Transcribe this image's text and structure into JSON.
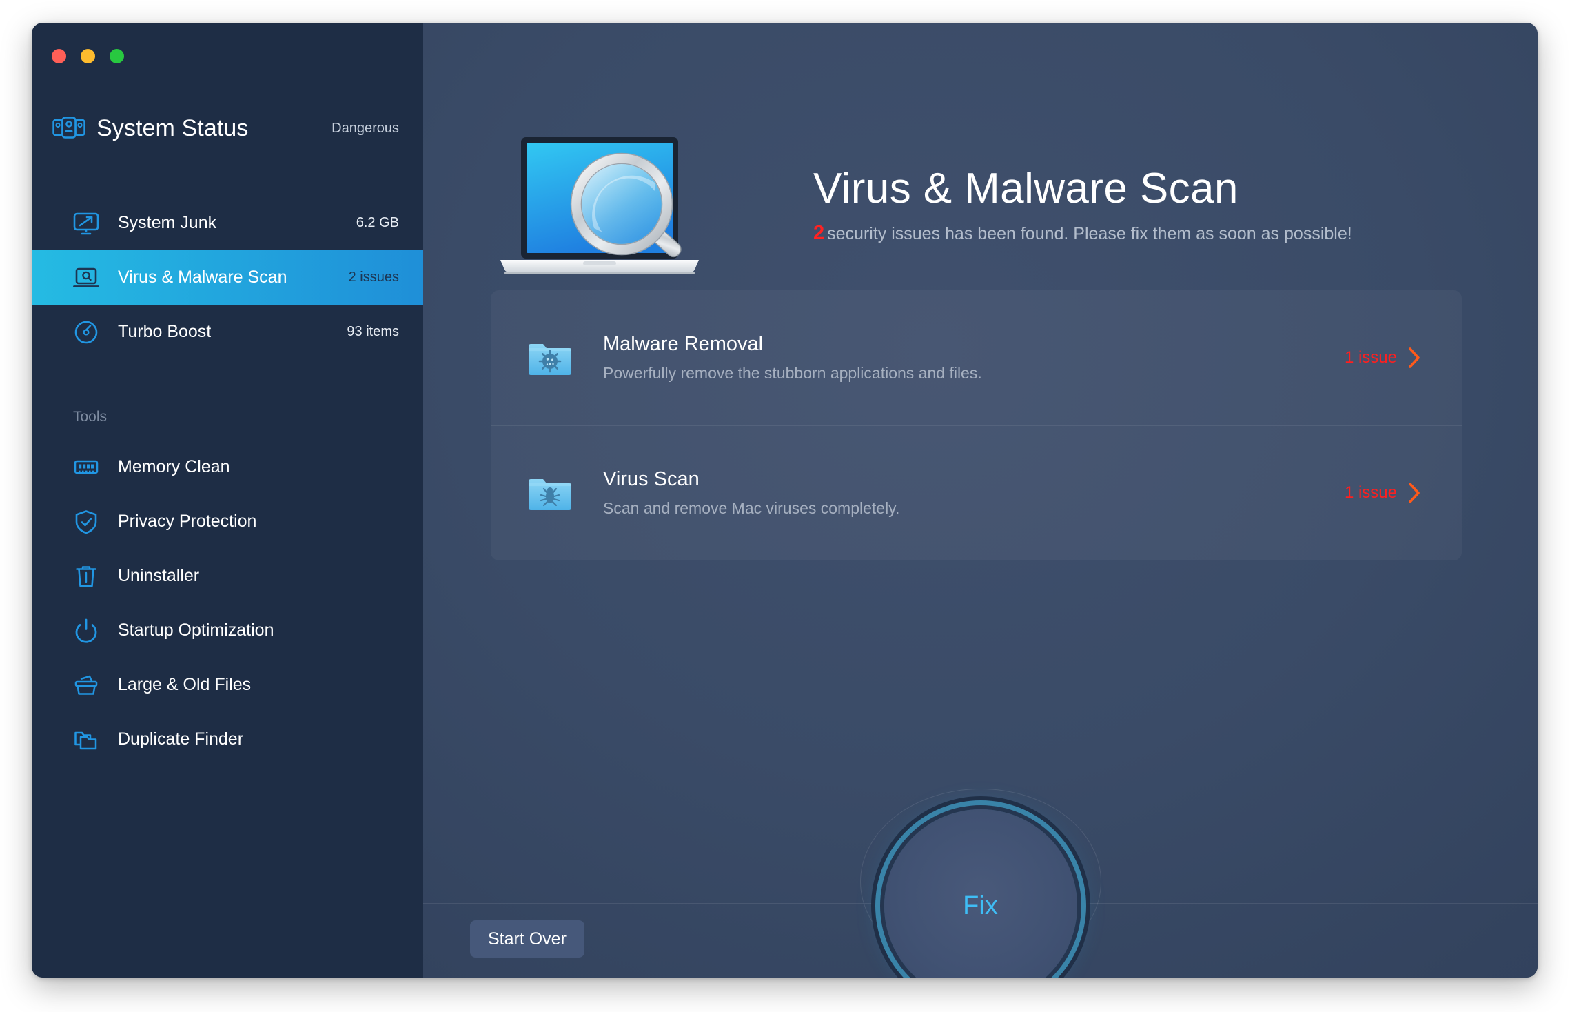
{
  "window": {
    "traffic_lights": [
      "close",
      "minimize",
      "maximize"
    ]
  },
  "sidebar": {
    "status": {
      "icon": "system-status-icon",
      "title": "System Status",
      "value": "Dangerous"
    },
    "main_items": [
      {
        "icon": "system-junk-icon",
        "label": "System Junk",
        "value": "6.2 GB",
        "selected": false
      },
      {
        "icon": "virus-scan-laptop-icon",
        "label": "Virus & Malware Scan",
        "value": "2 issues",
        "selected": true
      },
      {
        "icon": "turbo-boost-icon",
        "label": "Turbo Boost",
        "value": "93 items",
        "selected": false
      }
    ],
    "tools_heading": "Tools",
    "tools": [
      {
        "icon": "memory-clean-icon",
        "label": "Memory Clean"
      },
      {
        "icon": "privacy-protection-icon",
        "label": "Privacy Protection"
      },
      {
        "icon": "uninstaller-icon",
        "label": "Uninstaller"
      },
      {
        "icon": "startup-optimization-icon",
        "label": "Startup Optimization"
      },
      {
        "icon": "large-old-files-icon",
        "label": "Large & Old Files"
      },
      {
        "icon": "duplicate-finder-icon",
        "label": "Duplicate Finder"
      }
    ]
  },
  "main": {
    "hero": {
      "illustration": "laptop-magnifier-icon",
      "title": "Virus & Malware Scan",
      "subtitle_count": "2",
      "subtitle_text": "security issues has been found. Please fix them as soon as possible!"
    },
    "rows": [
      {
        "icon": "malware-folder-icon",
        "title": "Malware Removal",
        "description": "Powerfully remove the stubborn applications and files.",
        "issue": "1 issue",
        "chevron": "chevron-right-icon"
      },
      {
        "icon": "virus-folder-icon",
        "title": "Virus Scan",
        "description": "Scan and remove Mac viruses completely.",
        "issue": "1 issue",
        "chevron": "chevron-right-icon"
      }
    ]
  },
  "footer": {
    "start_over_label": "Start Over",
    "fix_label": "Fix"
  },
  "colors": {
    "sidebar_bg": "#1e2d45",
    "selection_start": "#25bbe3",
    "selection_end": "#1f8fd8",
    "accent_blue": "#2196e3",
    "issue_red": "#ff1f1f",
    "fix_cyan": "#3fbdf5"
  }
}
